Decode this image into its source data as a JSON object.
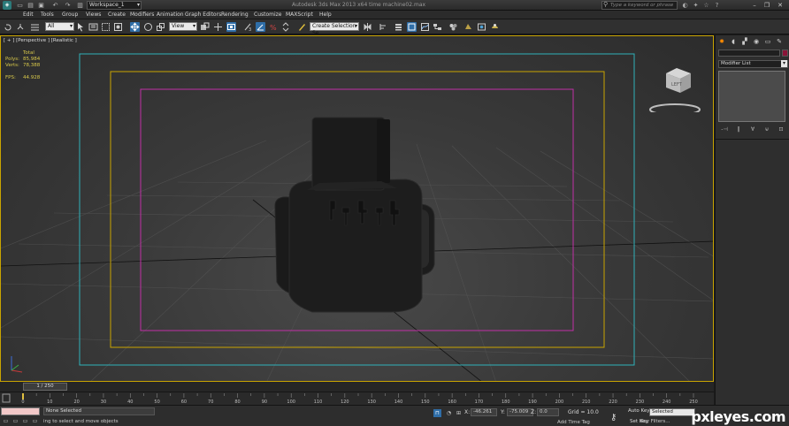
{
  "titlebar": {
    "workspace": "Workspace_1",
    "title": "Autodesk 3ds Max 2013 x64      time machine02.max",
    "search_placeholder": "Type a keyword or phrase"
  },
  "menu": [
    "Edit",
    "Tools",
    "Group",
    "Views",
    "Create",
    "Modifiers",
    "Animation",
    "Graph Editors",
    "Rendering",
    "Customize",
    "MAXScript",
    "Help"
  ],
  "toolbar": {
    "filter_value": "All",
    "coord_system": "View",
    "selection_set": "Create Selection Se"
  },
  "viewport": {
    "label": "[ + ] [Perspective ] [Realistic ]",
    "stats": {
      "header": "Total",
      "polys_label": "Polys:",
      "polys_value": "85,984",
      "verts_label": "Verts:",
      "verts_value": "78,388",
      "fps_label": "FPS:",
      "fps_value": "44.928"
    },
    "viewcube_face": "LEFT"
  },
  "command_panel": {
    "modifier_list": "Modifier List"
  },
  "timeline": {
    "frame_readout": "1 / 250",
    "ticks": [
      0,
      10,
      20,
      30,
      40,
      50,
      60,
      70,
      80,
      90,
      100,
      110,
      120,
      130,
      140,
      150,
      160,
      170,
      180,
      190,
      200,
      210,
      220,
      230,
      240,
      250
    ]
  },
  "status": {
    "selection": "None Selected",
    "prompt": "ing to select and move objects",
    "x_label": "X:",
    "x_value": "-46.261",
    "y_label": "Y:",
    "y_value": "-75.009",
    "z_label": "Z:",
    "z_value": "0.0",
    "grid": "Grid = 10.0",
    "add_time_tag": "Add Time Tag",
    "auto_key": "Auto Key",
    "selected": "Selected",
    "set_key": "Set Key",
    "key_filters": "Key Filters..."
  },
  "watermark": "pxleyes.com",
  "colors": {
    "active_blue": "#2f6ea8",
    "viewport_border": "#c9a400",
    "safe_frame_outer": "#2fb1b9",
    "safe_frame_action": "#c9a400",
    "safe_frame_title": "#c02fa6",
    "stats_text": "#d8c84a",
    "object_color": "#8a1437"
  }
}
